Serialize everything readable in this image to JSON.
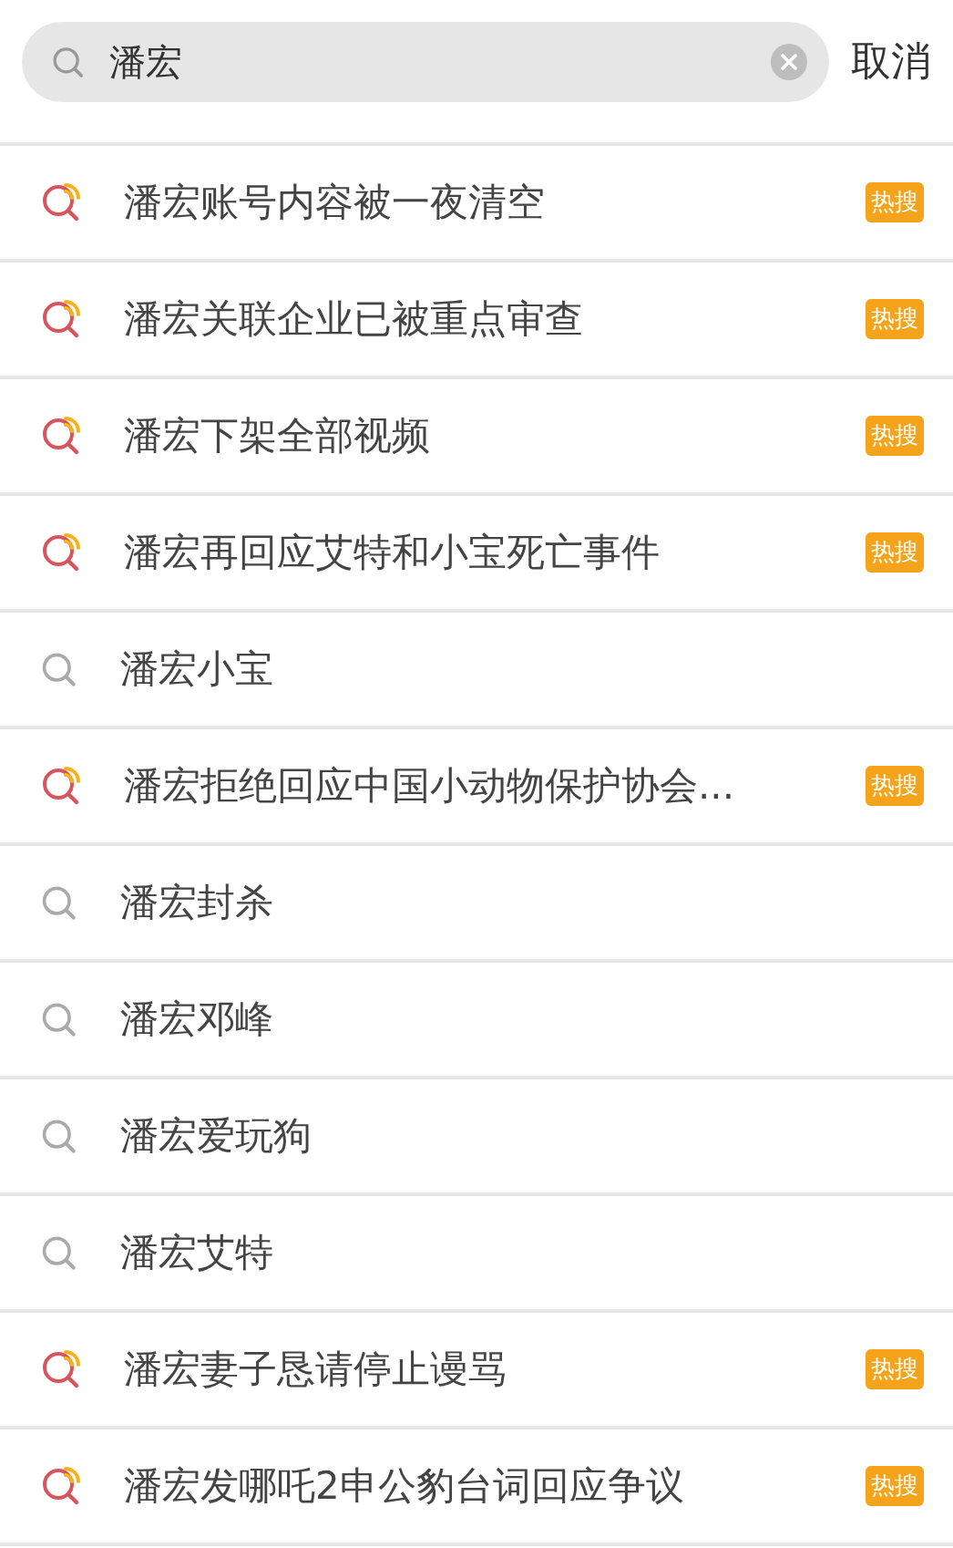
{
  "search": {
    "value": "潘宏"
  },
  "cancel": "取消",
  "suggestions": [
    {
      "kind": "hot",
      "text": "潘宏账号内容被一夜清空",
      "badge": "热搜"
    },
    {
      "kind": "hot",
      "text": "潘宏关联企业已被重点审查",
      "badge": "热搜"
    },
    {
      "kind": "hot",
      "text": "潘宏下架全部视频",
      "badge": "热搜"
    },
    {
      "kind": "hot",
      "text": "潘宏再回应艾特和小宝死亡事件",
      "badge": "热搜"
    },
    {
      "kind": "plain",
      "text": "潘宏小宝"
    },
    {
      "kind": "hot",
      "text": "潘宏拒绝回应中国小动物保护协会...",
      "badge": "热搜"
    },
    {
      "kind": "plain",
      "text": "潘宏封杀"
    },
    {
      "kind": "plain",
      "text": "潘宏邓峰"
    },
    {
      "kind": "plain",
      "text": "潘宏爱玩狗"
    },
    {
      "kind": "plain",
      "text": "潘宏艾特"
    },
    {
      "kind": "hot",
      "text": "潘宏妻子恳请停止谩骂",
      "badge": "热搜"
    },
    {
      "kind": "hot",
      "text": "潘宏发哪吒2申公豹台词回应争议",
      "badge": "热搜"
    }
  ]
}
